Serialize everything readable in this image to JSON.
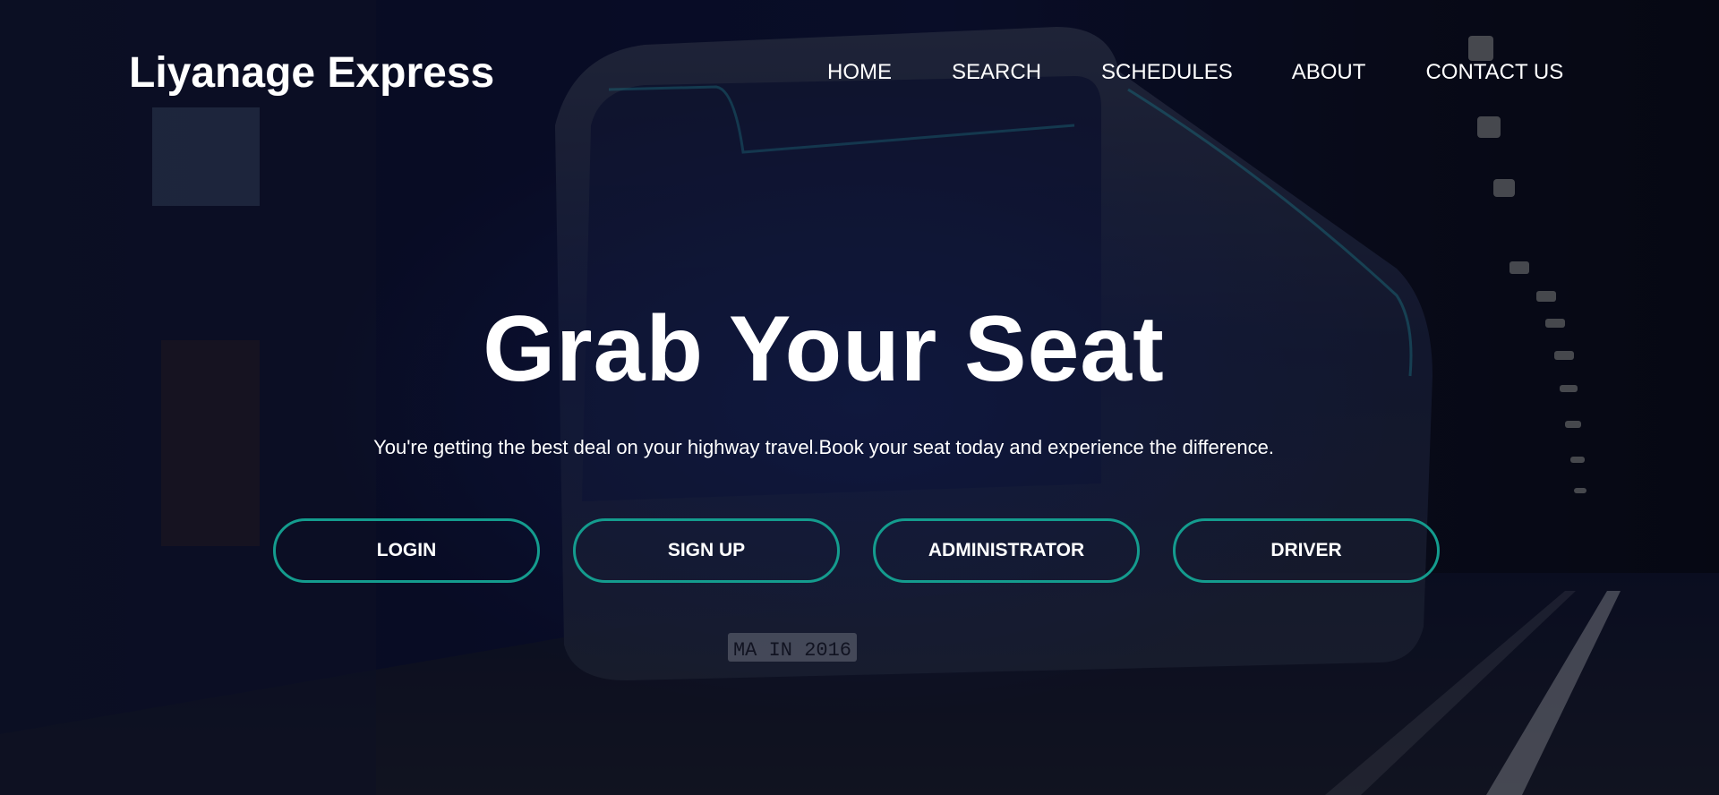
{
  "brand": {
    "name": "Liyanage Express"
  },
  "nav": {
    "items": [
      {
        "label": "HOME"
      },
      {
        "label": "SEARCH"
      },
      {
        "label": "SCHEDULES"
      },
      {
        "label": "ABOUT"
      },
      {
        "label": "CONTACT US"
      }
    ]
  },
  "hero": {
    "headline": "Grab Your Seat",
    "tagline": "You're getting the best deal on your highway travel.Book your seat today and experience the difference.",
    "background_image": "bus-in-tunnel",
    "plate_text": "MA IN 2016",
    "buttons": [
      {
        "label": "LOGIN"
      },
      {
        "label": "SIGN UP"
      },
      {
        "label": "ADMINISTRATOR"
      },
      {
        "label": "DRIVER"
      }
    ]
  },
  "colors": {
    "button_border": "#149c8e",
    "text": "#ffffff",
    "overlay": "#070a1f"
  }
}
